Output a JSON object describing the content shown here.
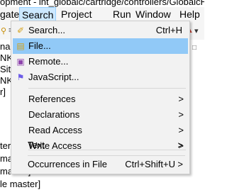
{
  "window_title": "opment - int_globalc/cartridge/controllers/GlobalcHe",
  "menubar": {
    "items": [
      "gate",
      "Search",
      "Project",
      "Run",
      "Window",
      "Help"
    ],
    "active": "Search"
  },
  "background_lines": [
    "naste",
    "NK-S",
    "SiteG",
    "NK-Sit",
    "r]",
    "",
    "ter]",
    "mast",
    "master]",
    "le master]"
  ],
  "menu": {
    "items": [
      {
        "label": "Search...",
        "shortcut": "Ctrl+H",
        "icon": "search-flashlight-icon"
      },
      {
        "label": "File...",
        "shortcut": "",
        "icon": "file-search-icon",
        "highlighted": true
      },
      {
        "label": "Remote...",
        "shortcut": "",
        "icon": "remote-search-icon"
      },
      {
        "label": "JavaScript...",
        "shortcut": "",
        "icon": "javascript-search-icon"
      },
      {
        "label": "References",
        "submenu": true
      },
      {
        "label": "Declarations",
        "submenu": true
      },
      {
        "label": "Read Access",
        "submenu": true
      },
      {
        "label": "Write Access",
        "submenu": true
      },
      {
        "label": "Text",
        "submenu": true
      },
      {
        "label": "Occurrences in File",
        "shortcut": "Ctrl+Shift+U",
        "submenu": true
      }
    ],
    "arrow_glyph": ">"
  }
}
